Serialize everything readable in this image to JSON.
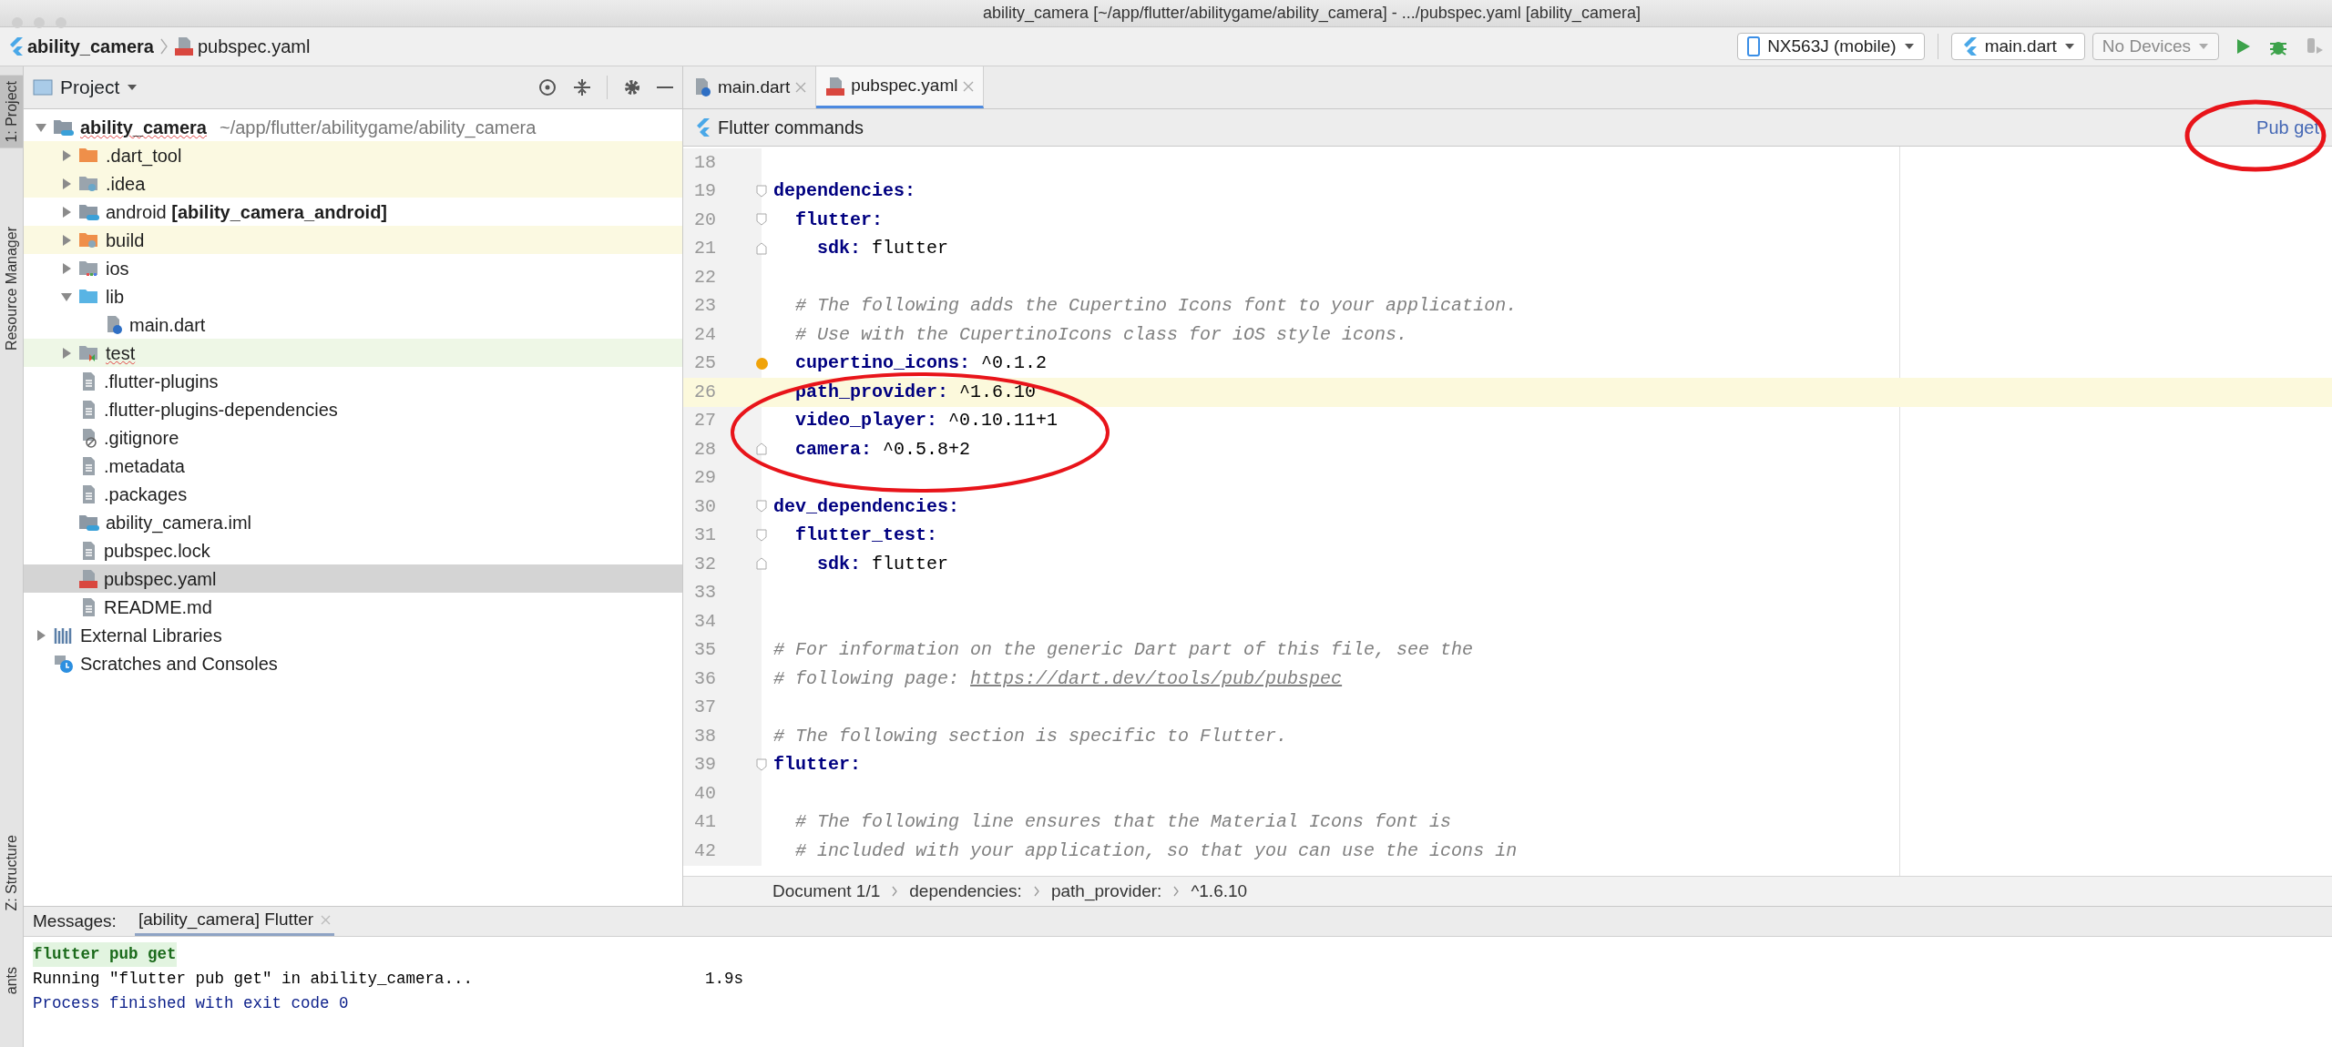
{
  "window": {
    "title": "ability_camera [~/app/flutter/abilitygame/ability_camera] - .../pubspec.yaml [ability_camera]"
  },
  "navigation_bar": {
    "breadcrumbs": [
      "ability_camera",
      "pubspec.yaml"
    ],
    "device": "NX563J (mobile)",
    "run_config": "main.dart",
    "target": {
      "label": "No Devices",
      "disabled": true
    },
    "actions": [
      {
        "kind": "run",
        "disabled": false
      },
      {
        "kind": "debug",
        "disabled": false
      },
      {
        "kind": "attach",
        "disabled": true
      }
    ]
  },
  "tool_strip": [
    {
      "label": "1: Project",
      "selected": true
    },
    {
      "label": "Resource Manager",
      "selected": false
    },
    {
      "label": "Z: Structure",
      "selected": false
    },
    {
      "label": "ants",
      "selected": false
    }
  ],
  "project_panel": {
    "title": "Project",
    "tree": [
      {
        "label": "ability_camera",
        "detail": "~/app/flutter/abilitygame/ability_camera",
        "kind": "module",
        "excluded": false,
        "typo": true,
        "expanded": true,
        "selected": false,
        "children": [
          {
            "label": ".dart_tool",
            "kind": "folder",
            "excluded": true,
            "typo": false,
            "expanded": false,
            "selected": false
          },
          {
            "label": ".idea",
            "kind": "config",
            "excluded": true,
            "typo": false,
            "expanded": false,
            "selected": false
          },
          {
            "label": "android **[ability_camera_android]**",
            "kind": "module",
            "excluded": false,
            "typo": false,
            "expanded": false,
            "selected": false
          },
          {
            "label": "build",
            "kind": "output",
            "excluded": true,
            "typo": false,
            "expanded": false,
            "selected": false
          },
          {
            "label": "ios",
            "kind": "platform",
            "excluded": false,
            "typo": false,
            "expanded": false,
            "selected": false
          },
          {
            "label": "lib",
            "kind": "source",
            "excluded": false,
            "typo": false,
            "expanded": true,
            "selected": false,
            "children": [
              {
                "label": "main.dart",
                "kind": "dart",
                "excluded": false,
                "typo": false,
                "selected": false
              }
            ]
          },
          {
            "label": "test",
            "kind": "tests",
            "excluded": false,
            "typo": true,
            "expanded": false,
            "selected": false
          },
          {
            "label": ".flutter-plugins",
            "kind": "file",
            "excluded": false,
            "typo": false,
            "selected": false
          },
          {
            "label": ".flutter-plugins-dependencies",
            "kind": "file",
            "excluded": false,
            "typo": false,
            "selected": false
          },
          {
            "label": ".gitignore",
            "kind": "ignore",
            "excluded": false,
            "typo": false,
            "selected": false
          },
          {
            "label": ".metadata",
            "kind": "file",
            "excluded": false,
            "typo": false,
            "selected": false
          },
          {
            "label": ".packages",
            "kind": "file",
            "excluded": false,
            "typo": false,
            "selected": false
          },
          {
            "label": "ability_camera.iml",
            "kind": "module",
            "excluded": false,
            "typo": false,
            "selected": false
          },
          {
            "label": "pubspec.lock",
            "kind": "file",
            "excluded": false,
            "typo": false,
            "selected": false
          },
          {
            "label": "pubspec.yaml",
            "kind": "yaml",
            "excluded": false,
            "typo": false,
            "selected": true
          },
          {
            "label": "README.md",
            "kind": "file",
            "excluded": false,
            "typo": false,
            "selected": false
          }
        ]
      },
      {
        "label": "External Libraries",
        "kind": "libraries",
        "excluded": false,
        "typo": false,
        "expanded": false,
        "selected": false
      },
      {
        "label": "Scratches and Consoles",
        "kind": "scratches",
        "excluded": false,
        "typo": false,
        "selected": false
      }
    ]
  },
  "editor": {
    "tabs": [
      {
        "label": "main.dart",
        "kind": "dart",
        "selected": false
      },
      {
        "label": "pubspec.yaml",
        "kind": "yaml",
        "selected": true
      }
    ],
    "commands_bar": {
      "title": "Flutter commands",
      "action": "Pub get"
    },
    "lines": [
      {
        "number": "18",
        "kind": "plain"
      },
      {
        "number": "19",
        "kind": "opener",
        "segments": [
          {
            "kind": "key",
            "text": "dependencies:"
          }
        ]
      },
      {
        "number": "20",
        "kind": "opener",
        "segments": [
          {
            "kind": "key",
            "text": "  flutter:"
          }
        ]
      },
      {
        "number": "21",
        "kind": "closer",
        "segments": [
          {
            "kind": "key",
            "text": "    sdk:"
          },
          {
            "kind": "plain",
            "text": " flutter"
          }
        ]
      },
      {
        "number": "22",
        "kind": "plain"
      },
      {
        "number": "23",
        "kind": "plain",
        "segments": [
          {
            "kind": "comment",
            "text": "  # The following adds the Cupertino Icons font to your application."
          }
        ]
      },
      {
        "number": "24",
        "kind": "plain",
        "segments": [
          {
            "kind": "comment",
            "text": "  # Use with the CupertinoIcons class for iOS style icons."
          }
        ]
      },
      {
        "number": "25",
        "kind": "plain",
        "marker": true,
        "segments": [
          {
            "kind": "key",
            "text": "  cupertino_icons:"
          },
          {
            "kind": "plain",
            "text": " ^0.1.2"
          }
        ]
      },
      {
        "number": "26",
        "kind": "plain",
        "current": true,
        "segments": [
          {
            "kind": "key",
            "text": "  path_provider:"
          },
          {
            "kind": "plain",
            "text": " ^1.6.10"
          }
        ]
      },
      {
        "number": "27",
        "kind": "plain",
        "segments": [
          {
            "kind": "key",
            "text": "  video_player:"
          },
          {
            "kind": "plain",
            "text": " ^0.10.11+1"
          }
        ]
      },
      {
        "number": "28",
        "kind": "closer",
        "segments": [
          {
            "kind": "key",
            "text": "  camera:"
          },
          {
            "kind": "plain",
            "text": " ^0.5.8+2"
          }
        ]
      },
      {
        "number": "29",
        "kind": "plain"
      },
      {
        "number": "30",
        "kind": "opener",
        "segments": [
          {
            "kind": "key",
            "text": "dev_dependencies:"
          }
        ]
      },
      {
        "number": "31",
        "kind": "opener",
        "segments": [
          {
            "kind": "key",
            "text": "  flutter_test:"
          }
        ]
      },
      {
        "number": "32",
        "kind": "closer",
        "segments": [
          {
            "kind": "key",
            "text": "    sdk:"
          },
          {
            "kind": "plain",
            "text": " flutter"
          }
        ]
      },
      {
        "number": "33",
        "kind": "plain"
      },
      {
        "number": "34",
        "kind": "plain"
      },
      {
        "number": "35",
        "kind": "plain",
        "segments": [
          {
            "kind": "comment",
            "text": "# For information on the generic Dart part of this file, see the"
          }
        ]
      },
      {
        "number": "36",
        "kind": "plain",
        "segments": [
          {
            "kind": "comment",
            "text": "# following page: "
          },
          {
            "kind": "link",
            "text": "https://dart.dev/tools/pub/pubspec"
          }
        ]
      },
      {
        "number": "37",
        "kind": "plain"
      },
      {
        "number": "38",
        "kind": "plain",
        "segments": [
          {
            "kind": "comment",
            "text": "# The following section is specific to Flutter."
          }
        ]
      },
      {
        "number": "39",
        "kind": "opener",
        "segments": [
          {
            "kind": "key",
            "text": "flutter:"
          }
        ]
      },
      {
        "number": "40",
        "kind": "plain"
      },
      {
        "number": "41",
        "kind": "plain",
        "segments": [
          {
            "kind": "comment",
            "text": "  # The following line ensures that the Material Icons font is"
          }
        ]
      },
      {
        "number": "42",
        "kind": "plain",
        "segments": [
          {
            "kind": "comment",
            "text": "  # included with your application, so that you can use the icons in"
          }
        ]
      }
    ],
    "breadcrumbs": [
      "Document 1/1",
      "dependencies:",
      "path_provider:",
      "^1.6.10"
    ]
  },
  "messages": {
    "label": "Messages:",
    "tabs": [
      {
        "label": "[ability_camera] Flutter",
        "selected": true
      }
    ],
    "output": [
      {
        "kind": "command",
        "text": "flutter pub get"
      },
      {
        "kind": "info",
        "text": "Running \"flutter pub get\" in ability_camera...",
        "time": "1.9s"
      },
      {
        "kind": "result",
        "text": "Process finished with exit code 0"
      }
    ]
  }
}
